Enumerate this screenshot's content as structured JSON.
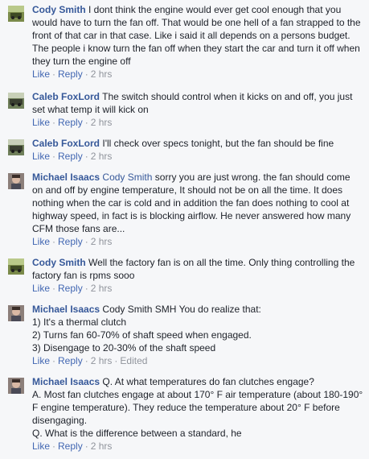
{
  "actions": {
    "like": "Like",
    "reply": "Reply",
    "dot": "·",
    "edited": "Edited"
  },
  "comments": [
    {
      "author": "Cody Smith",
      "text": "I dont think the engine would ever get cool enough that you would have to turn the fan off. That would be one hell of a fan strapped to the front of that car in that case. Like i said it all depends on a persons budget. The people i know turn the fan off when they start the car and turn it off when they turn the engine off",
      "time": "2 hrs"
    },
    {
      "author": "Caleb FoxLord",
      "text": "The switch should control when it kicks on and off, you just set what temp it will kick on",
      "time": "2 hrs"
    },
    {
      "author": "Caleb FoxLord",
      "text": "I'll check over specs tonight, but the fan should be fine",
      "time": "2 hrs"
    },
    {
      "author": "Michael Isaacs",
      "tag": "Cody Smith",
      "text": "sorry you are just wrong. the fan should come on and off by engine temperature, It should not be on all the time. It does nothing when the car is cold and in addition the fan does nothing to cool at highway speed, in fact is is blocking airflow. He never answered how many CFM those fans are...",
      "time": "2 hrs"
    },
    {
      "author": "Cody Smith",
      "text": "Well the factory fan is on all the time. Only thing controlling the factory fan is rpms sooo",
      "time": "2 hrs"
    },
    {
      "author": "Michael Isaacs",
      "tag": "Cody Smith",
      "text": "SMH You do realize that:",
      "lines": [
        "1) It's a thermal clutch",
        "2) Turns fan 60-70% of shaft speed when engaged.",
        "3) Disengage to 20-30% of the shaft speed"
      ],
      "time": "2 hrs"
    },
    {
      "author": "Michael Isaacs",
      "text": "Q. At what temperatures do fan clutches engage?",
      "lines": [
        "A. Most fan clutches engage at about 170° F air temperature (about 180-190° F engine temperature). They reduce the temperature about 20° F before disengaging.",
        "Q. What is the difference between a standard, he"
      ],
      "time": "2 hrs"
    }
  ]
}
